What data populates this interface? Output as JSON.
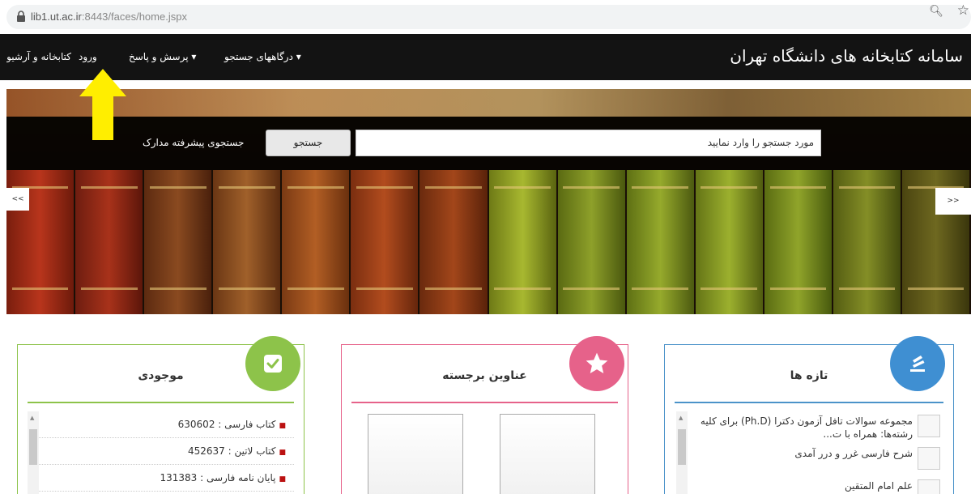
{
  "browser": {
    "url_host": "lib1.ut.ac.ir",
    "url_rest": ":8443/faces/home.jspx"
  },
  "nav": {
    "site_title": "سامانه کتابخانه های دانشگاه تهران",
    "search_portals": "درگاههای جستجو ▾",
    "qa": "پرسش و پاسخ ▾",
    "login": "ورود",
    "libraries": "کتابخانه و آرشیو"
  },
  "hero": {
    "search_placeholder": "مورد جستجو را وارد نمایید",
    "search_button": "جستجو",
    "advanced_search": "جستجوی پیشرفته مدارک",
    "prev_arrow": "<<",
    "next_arrow": ">>"
  },
  "panels": {
    "available": {
      "title": "موجودی",
      "items": [
        "کتاب فارسی : 630602",
        "کتاب لاتین : 452637",
        "پایان نامه فارسی : 131383"
      ]
    },
    "featured": {
      "title": "عناوین برجسته"
    },
    "new": {
      "title": "تازه ها",
      "items": [
        "مجموعه سوالات تافل آزمون دکترا (Ph.D) برای کلیه رشته‌ها: همراه با ت...",
        "شرح فارسی غرر و درر آمدی",
        "علم امام المتقین"
      ]
    }
  },
  "colors": {
    "green": "#8dc34a",
    "pink": "#e6628a",
    "blue": "#4b93c9",
    "annotation": "#ffee00"
  }
}
